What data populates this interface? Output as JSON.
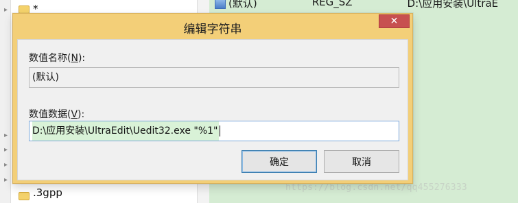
{
  "background": {
    "tree": {
      "top_label": "*",
      "bottom_label": ".3gpp"
    },
    "values_row": {
      "name": "(默认)",
      "type": "REG_SZ",
      "data": "D:\\应用安装\\UltraE"
    },
    "watermark": "https://blog.csdn.net/qq455276333"
  },
  "dialog": {
    "title": "编辑字符串",
    "close_icon": "close-icon",
    "value_name": {
      "label_prefix": "数值名称(",
      "mnemonic": "N",
      "label_suffix": "):",
      "value": "(默认)"
    },
    "value_data": {
      "label_prefix": "数值数据(",
      "mnemonic": "V",
      "label_suffix": "):",
      "value": "D:\\应用安装\\UltraEdit\\Uedit32.exe \"%1\""
    },
    "buttons": {
      "ok": "确定",
      "cancel": "取消"
    }
  },
  "colors": {
    "titlebar": "#f3cf78",
    "close_button": "#c75050",
    "values_pane": "#d5ecd3",
    "selection": "#d9f2d7",
    "default_button_border": "#3c7fb1"
  }
}
